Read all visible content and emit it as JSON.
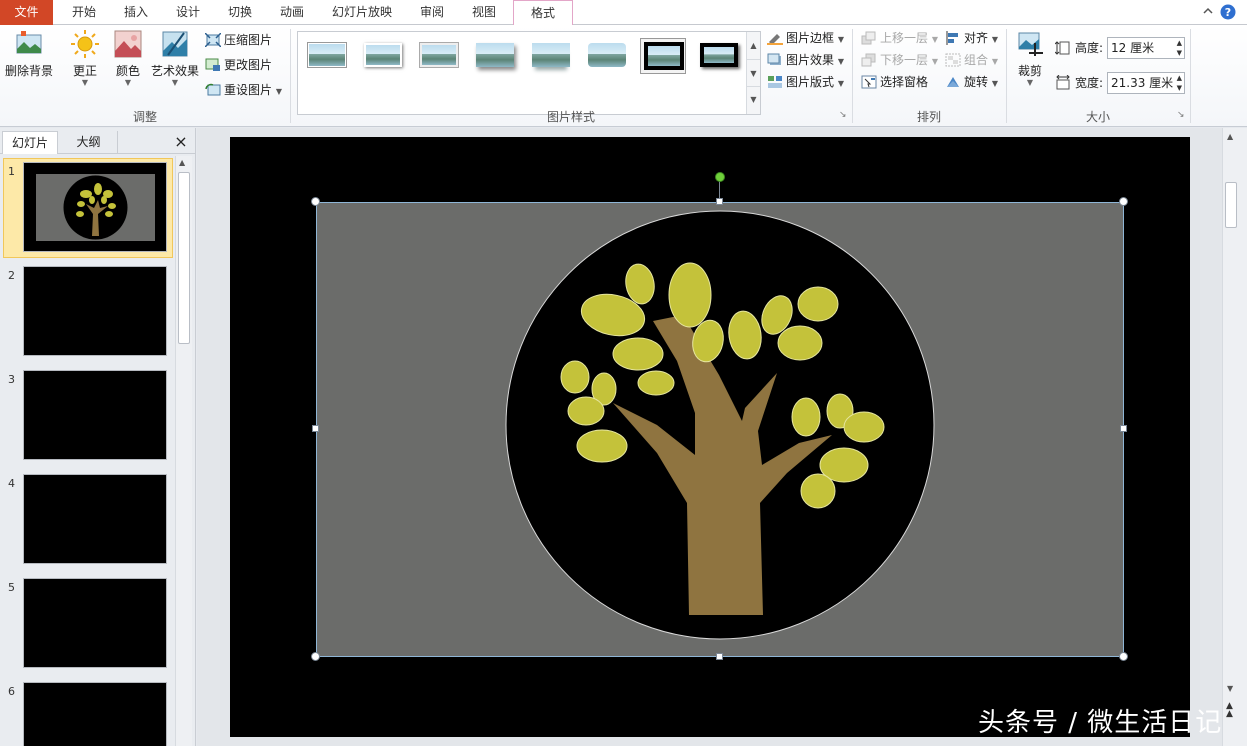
{
  "tabs": [
    {
      "label": "文件"
    },
    {
      "label": "开始"
    },
    {
      "label": "插入"
    },
    {
      "label": "设计"
    },
    {
      "label": "切换"
    },
    {
      "label": "动画"
    },
    {
      "label": "幻灯片放映"
    },
    {
      "label": "审阅"
    },
    {
      "label": "视图"
    },
    {
      "label": "格式"
    }
  ],
  "ribbon": {
    "adjust": {
      "remove_bg": "删除背景",
      "corrections": "更正",
      "color": "颜色",
      "artistic": "艺术效果",
      "compress": "压缩图片",
      "change": "更改图片",
      "reset": "重设图片",
      "group_label": "调整"
    },
    "styles": {
      "border": "图片边框",
      "effects": "图片效果",
      "layout": "图片版式",
      "group_label": "图片样式"
    },
    "arrange": {
      "bring_forward": "上移一层",
      "send_backward": "下移一层",
      "selection_pane": "选择窗格",
      "align": "对齐",
      "group": "组合",
      "rotate": "旋转",
      "group_label": "排列"
    },
    "size": {
      "crop": "裁剪",
      "height_label": "高度:",
      "height_value": "12 厘米",
      "width_label": "宽度:",
      "width_value": "21.33 厘米",
      "group_label": "大小"
    }
  },
  "panel": {
    "tab_slides": "幻灯片",
    "tab_outline": "大纲",
    "close": "×",
    "slide_numbers": [
      "1",
      "2",
      "3",
      "4",
      "5",
      "6"
    ]
  },
  "watermark": "头条号 / 微生活日记",
  "colors": {
    "file_tab": "#d24726",
    "active_tab_border": "#e3a6c8",
    "leaf": "#c4c23a",
    "trunk": "#8f7440",
    "picture_bg": "#6b6c6a",
    "slide_bg": "#000000"
  }
}
